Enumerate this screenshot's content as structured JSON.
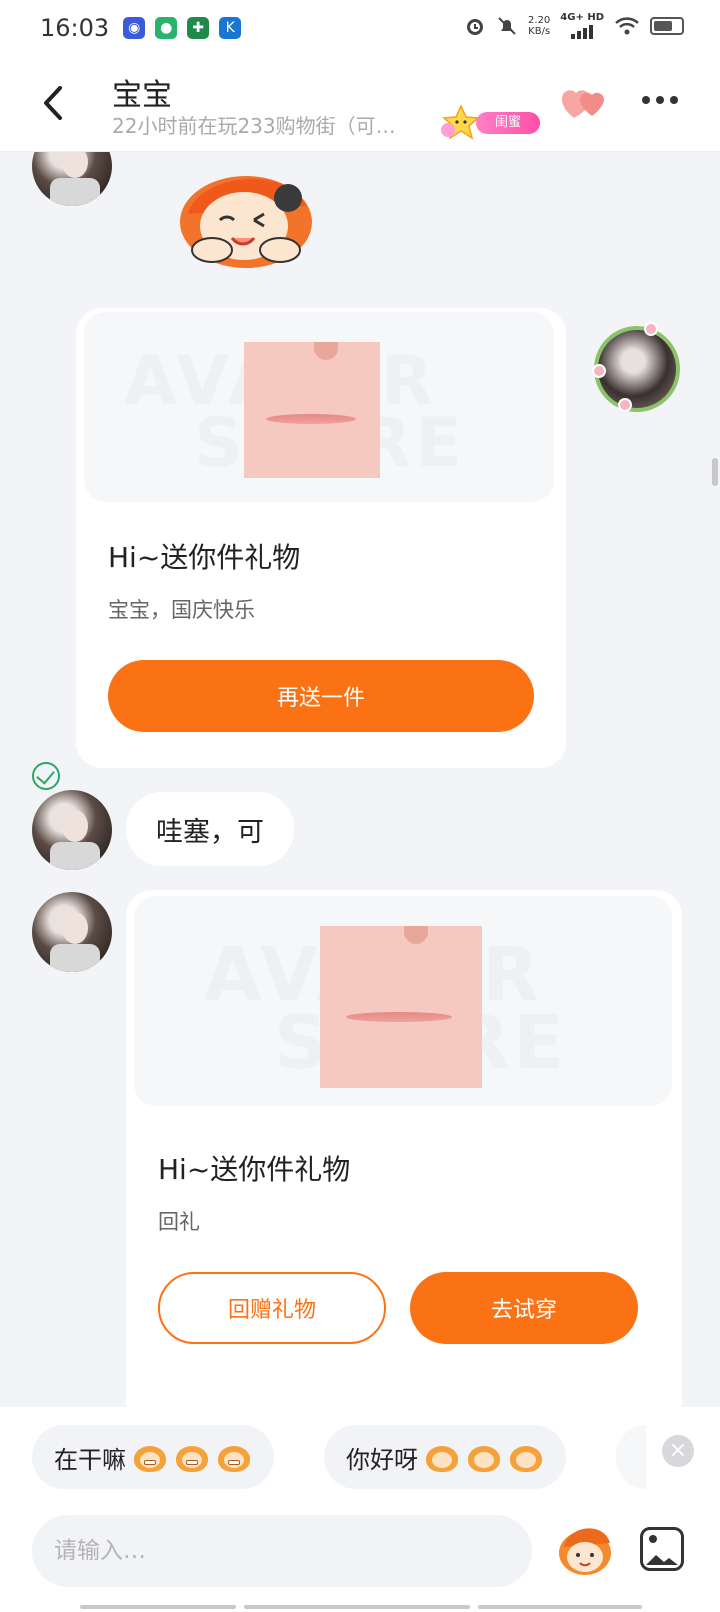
{
  "status_bar": {
    "time": "16:03",
    "speed": "2.20\nKB/s",
    "network": "4G+ HD",
    "icons": [
      "alarm-icon",
      "mute-icon",
      "signal-icon",
      "wifi-icon",
      "battery-icon"
    ]
  },
  "header": {
    "title": "宝宝",
    "subtitle": "22小时前在玩233购物街（可…",
    "badge_label": "闺蜜",
    "icons": [
      "back-icon",
      "heart-icon",
      "more-icon"
    ]
  },
  "messages": {
    "gift1": {
      "watermark_top": "AVATAR",
      "watermark_bottom": "STORE",
      "title": "Hi~送你件礼物",
      "message": "宝宝，国庆快乐",
      "button": "再送一件"
    },
    "text_reply": "哇塞，可",
    "gift2": {
      "watermark_top": "AVATAR",
      "watermark_bottom": "STORE",
      "title": "Hi~送你件礼物",
      "message": "回礼",
      "button_return": "回赠礼物",
      "button_try": "去试穿"
    }
  },
  "quick_replies": [
    {
      "text": "在干嘛"
    },
    {
      "text": "你好呀"
    }
  ],
  "input": {
    "placeholder": "请输入…"
  },
  "colors": {
    "accent": "#fb7214",
    "badge": "#ff4fa8",
    "check": "#2aa86a",
    "background": "#f3f4f7"
  }
}
